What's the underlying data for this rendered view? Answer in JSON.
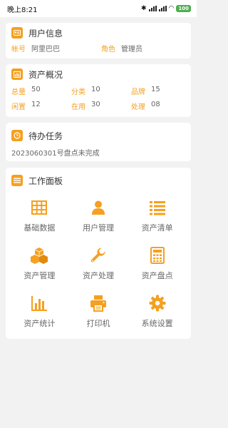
{
  "status_bar": {
    "time": "晚上8:21",
    "battery": "100"
  },
  "user_card": {
    "title": "用户信息",
    "account_label": "帐号",
    "account_value": "阿里巴巴",
    "role_label": "角色",
    "role_value": "管理员"
  },
  "asset_overview": {
    "title": "资产概况",
    "rows": [
      [
        {
          "label": "总量",
          "value": "50"
        },
        {
          "label": "分类",
          "value": "10"
        },
        {
          "label": "品牌",
          "value": "15"
        }
      ],
      [
        {
          "label": "闲置",
          "value": "12"
        },
        {
          "label": "在用",
          "value": "30"
        },
        {
          "label": "处理",
          "value": "08"
        }
      ]
    ]
  },
  "todo": {
    "title": "待办任务",
    "item": "2023060301号盘点未完成"
  },
  "workbench": {
    "title": "工作面板",
    "tiles": [
      {
        "label": "基础数据",
        "icon": "table-grid-icon"
      },
      {
        "label": "用户管理",
        "icon": "user-icon"
      },
      {
        "label": "资产清单",
        "icon": "list-icon"
      },
      {
        "label": "资产管理",
        "icon": "boxes-icon"
      },
      {
        "label": "资产处理",
        "icon": "wrench-icon"
      },
      {
        "label": "资产盘点",
        "icon": "calculator-icon"
      },
      {
        "label": "资产统计",
        "icon": "bar-chart-icon"
      },
      {
        "label": "打印机",
        "icon": "printer-icon"
      },
      {
        "label": "系统设置",
        "icon": "gear-icon"
      }
    ]
  },
  "colors": {
    "accent": "#f5a020",
    "background": "#f2f2f2",
    "card": "#ffffff"
  }
}
